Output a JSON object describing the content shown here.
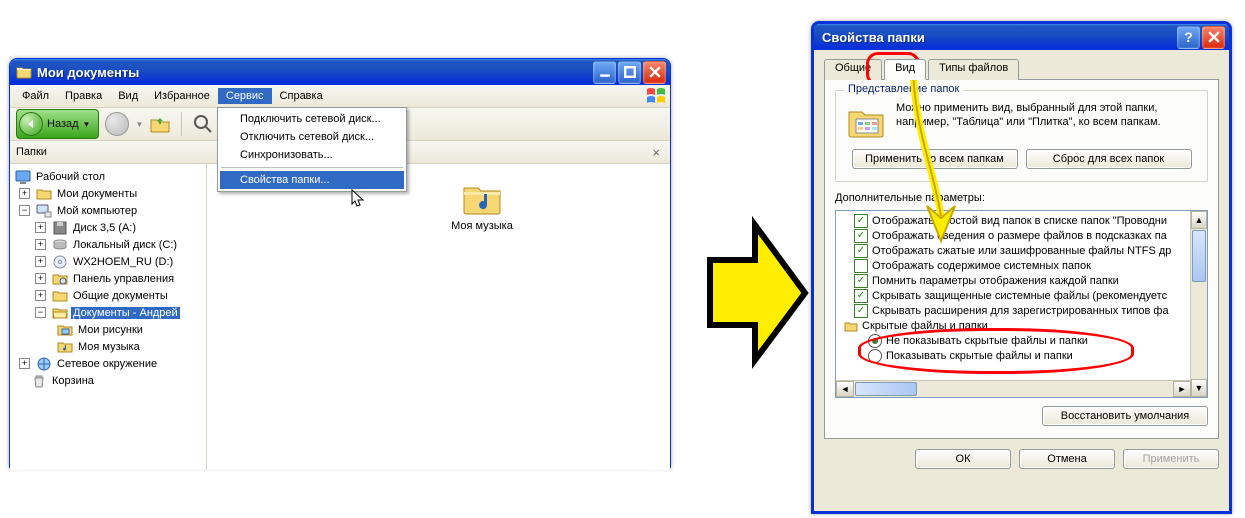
{
  "explorer": {
    "title": "Мои документы",
    "menus": {
      "file": "Файл",
      "edit": "Правка",
      "view": "Вид",
      "favorites": "Избранное",
      "tools": "Сервис",
      "help": "Справка"
    },
    "dropdown": {
      "map_drive": "Подключить сетевой диск...",
      "disconnect_drive": "Отключить сетевой диск...",
      "sync": "Синхронизовать...",
      "folder_options": "Свойства папки..."
    },
    "toolbar": {
      "back": "Назад"
    },
    "panes_label": "Папки",
    "tree": {
      "desktop": "Рабочий стол",
      "mydocs": "Мои документы",
      "mycomputer": "Мой компьютер",
      "floppy": "Диск 3,5 (A:)",
      "localdisk": "Локальный диск (C:)",
      "cddrive": "WX2HOEM_RU (D:)",
      "controlpanel": "Панель управления",
      "shareddocs": "Общие документы",
      "userdocs": "Документы - Андрей",
      "mypictures": "Мои рисунки",
      "mymusic": "Моя музыка",
      "network": "Сетевое окружение",
      "recycle": "Корзина"
    },
    "content": {
      "mymusic": "Моя музыка"
    }
  },
  "dialog": {
    "title": "Свойства папки",
    "tabs": {
      "general": "Общие",
      "view": "Вид",
      "filetypes": "Типы файлов"
    },
    "group_legend": "Представление папок",
    "group_text": "Можно применить вид, выбранный для этой папки, например, \"Таблица\" или \"Плитка\", ко всем папкам.",
    "btn_apply_all": "Применить ко всем папкам",
    "btn_reset_all": "Сброс для всех папок",
    "adv_label": "Дополнительные параметры:",
    "options": {
      "o1": "Отображать простой вид папок в списке папок \"Проводни",
      "o2": "Отображать сведения о размере файлов в подсказках па",
      "o3": "Отображать сжатые или зашифрованные файлы NTFS др",
      "o4": "Отображать содержимое системных папок",
      "o5": "Помнить параметры отображения каждой папки",
      "o6": "Скрывать защищенные системные файлы (рекомендуетс",
      "o7": "Скрывать расширения для зарегистрированных типов фа",
      "node": "Скрытые файлы и папки",
      "r1": "Не показывать скрытые файлы и папки",
      "r2": "Показывать скрытые файлы и папки"
    },
    "btn_restore": "Восстановить умолчания",
    "btn_ok": "ОК",
    "btn_cancel": "Отмена",
    "btn_apply": "Применить"
  }
}
